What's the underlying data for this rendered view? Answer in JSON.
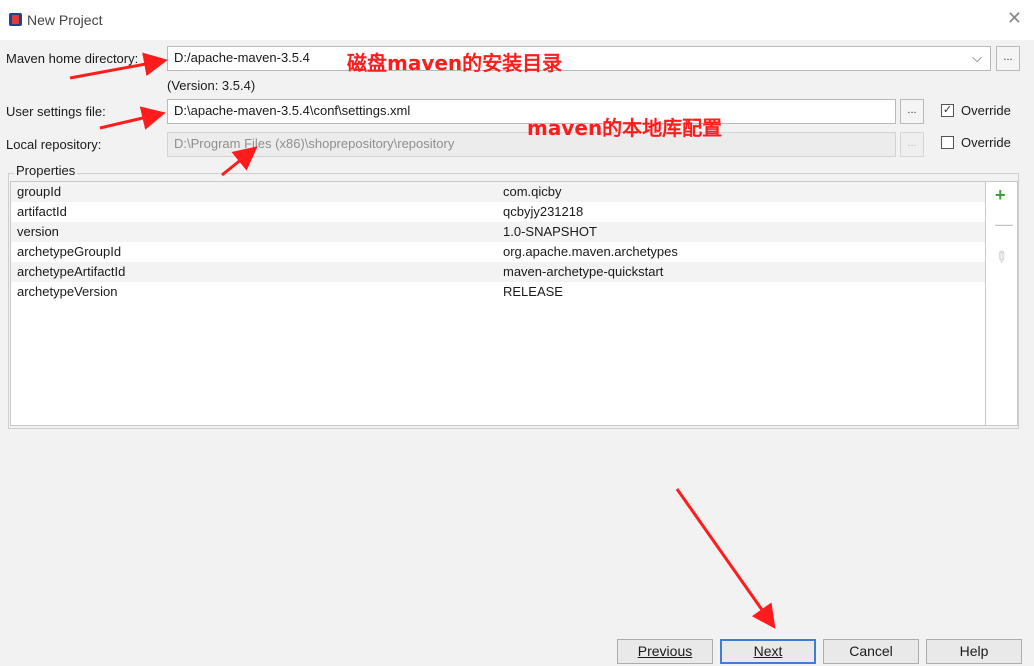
{
  "window": {
    "title": "New Project",
    "close_glyph": "✕"
  },
  "maven_home": {
    "label": "Maven home directory:",
    "value": "D:/apache-maven-3.5.4",
    "version": "(Version: 3.5.4)",
    "browse_label": "..."
  },
  "settings": {
    "label": "User settings file:",
    "value": "D:\\apache-maven-3.5.4\\conf\\settings.xml",
    "browse_label": "...",
    "override_label": "Override",
    "override_checked": true,
    "check_glyph": "✓"
  },
  "repo": {
    "label": "Local repository:",
    "value": "D:\\Program Files (x86)\\shoprepository\\repository",
    "browse_label": "...",
    "override_label": "Override",
    "override_checked": false
  },
  "properties": {
    "title": "Properties",
    "rows": [
      {
        "key": "groupId",
        "value": "com.qicby"
      },
      {
        "key": "artifactId",
        "value": "qcbyjy231218"
      },
      {
        "key": "version",
        "value": "1.0-SNAPSHOT"
      },
      {
        "key": "archetypeGroupId",
        "value": "org.apache.maven.archetypes"
      },
      {
        "key": "archetypeArtifactId",
        "value": "maven-archetype-quickstart"
      },
      {
        "key": "archetypeVersion",
        "value": "RELEASE"
      }
    ],
    "icons": {
      "add": "+",
      "remove": "—",
      "edit": "✎"
    }
  },
  "footer": {
    "previous": "Previous",
    "next": "Next",
    "cancel": "Cancel",
    "help": "Help"
  },
  "annotations": {
    "maven_dir_note": "磁盘maven的安装目录",
    "local_repo_note": "maven的本地库配置"
  },
  "colors": {
    "annotation": "#ff1c1c",
    "accent": "#3d7ed4",
    "add_icon": "#3aa03a"
  }
}
